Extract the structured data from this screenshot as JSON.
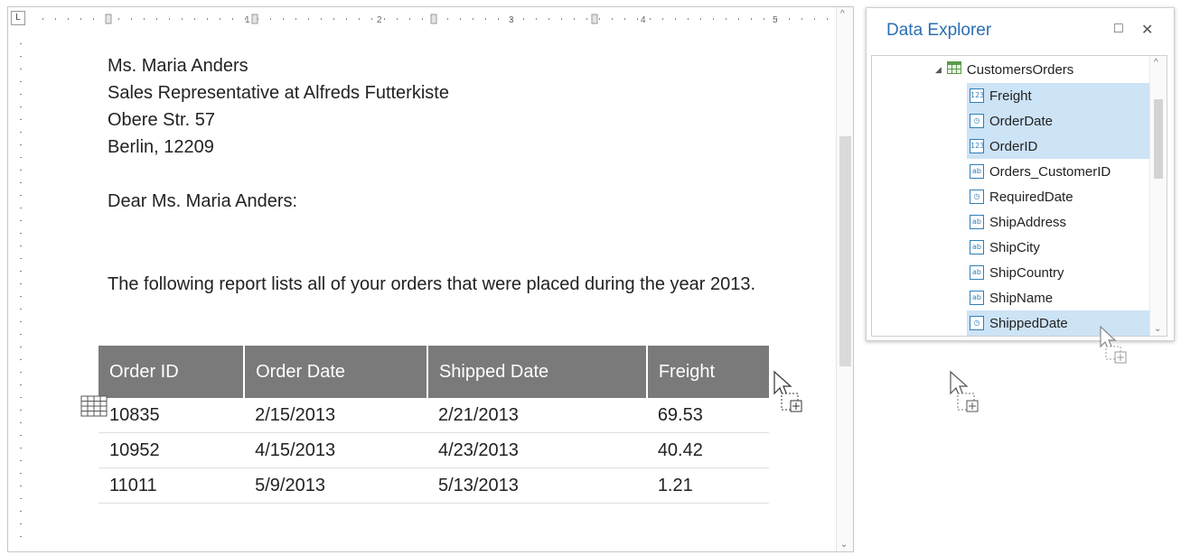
{
  "ruler": {
    "corner_label": "L",
    "tick_labels": [
      "1",
      "2",
      "3",
      "4",
      "5"
    ]
  },
  "letter": {
    "address_lines": [
      "Ms. Maria Anders",
      "Sales Representative at Alfreds Futterkiste",
      "Obere Str. 57",
      "Berlin, 12209"
    ],
    "salutation": "Dear Ms. Maria Anders:",
    "paragraph": "The following report lists all of your orders that were placed during the year 2013."
  },
  "orders_table": {
    "columns": [
      "Order ID",
      "Order Date",
      "Shipped Date",
      "Freight"
    ],
    "rows": [
      [
        "10835",
        "2/15/2013",
        "2/21/2013",
        "69.53"
      ],
      [
        "10952",
        "4/15/2013",
        "4/23/2013",
        "40.42"
      ],
      [
        "11011",
        "5/9/2013",
        "5/13/2013",
        "1.21"
      ]
    ]
  },
  "data_explorer": {
    "title": "Data Explorer",
    "maximize_icon": "□",
    "close_icon": "✕",
    "root": "CustomersOrders",
    "items": [
      {
        "label": "Freight",
        "type": "123",
        "selected": true
      },
      {
        "label": "OrderDate",
        "type": "clock",
        "selected": true
      },
      {
        "label": "OrderID",
        "type": "123",
        "selected": true
      },
      {
        "label": "Orders_CustomerID",
        "type": "ab",
        "selected": false
      },
      {
        "label": "RequiredDate",
        "type": "clock",
        "selected": false
      },
      {
        "label": "ShipAddress",
        "type": "ab",
        "selected": false
      },
      {
        "label": "ShipCity",
        "type": "ab",
        "selected": false
      },
      {
        "label": "ShipCountry",
        "type": "ab",
        "selected": false
      },
      {
        "label": "ShipName",
        "type": "ab",
        "selected": false
      },
      {
        "label": "ShippedDate",
        "type": "clock",
        "selected": true
      }
    ]
  },
  "colors": {
    "header_bg": "#7a7a7a",
    "selection_bg": "#cde3f6",
    "title_blue": "#2b6fb4",
    "icon_blue": "#2e7fb9"
  }
}
